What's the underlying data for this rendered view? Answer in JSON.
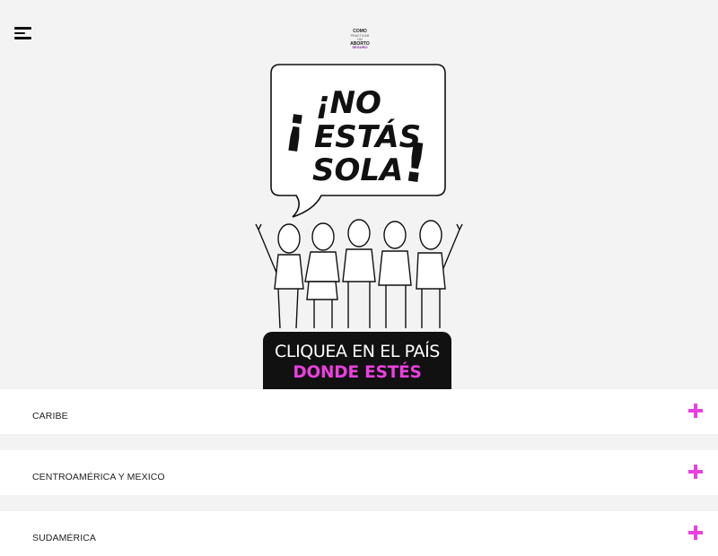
{
  "logo": {
    "line1": "COMO",
    "line2": "PRACTICAR UN",
    "line3": "ABORTO",
    "line4": "SEGURO"
  },
  "hero": {
    "speech_line1": "¡NO",
    "speech_line2": "ESTÁS",
    "speech_line3": "SOLA",
    "speech_exclaim": "!",
    "banner_line1": "CLIQUEA EN EL PAÍS",
    "banner_line2": "DONDE ESTÉS"
  },
  "regions": [
    {
      "label": "CARIBE"
    },
    {
      "label": "CENTROAMÉRICA Y MEXICO"
    },
    {
      "label": "SUDAMÉRICA"
    }
  ],
  "colors": {
    "accent": "#ea3fe0",
    "background": "#f4f3f4",
    "banner": "#111111"
  },
  "icons": {
    "menu": "hamburger-icon",
    "expand": "plus-icon"
  }
}
